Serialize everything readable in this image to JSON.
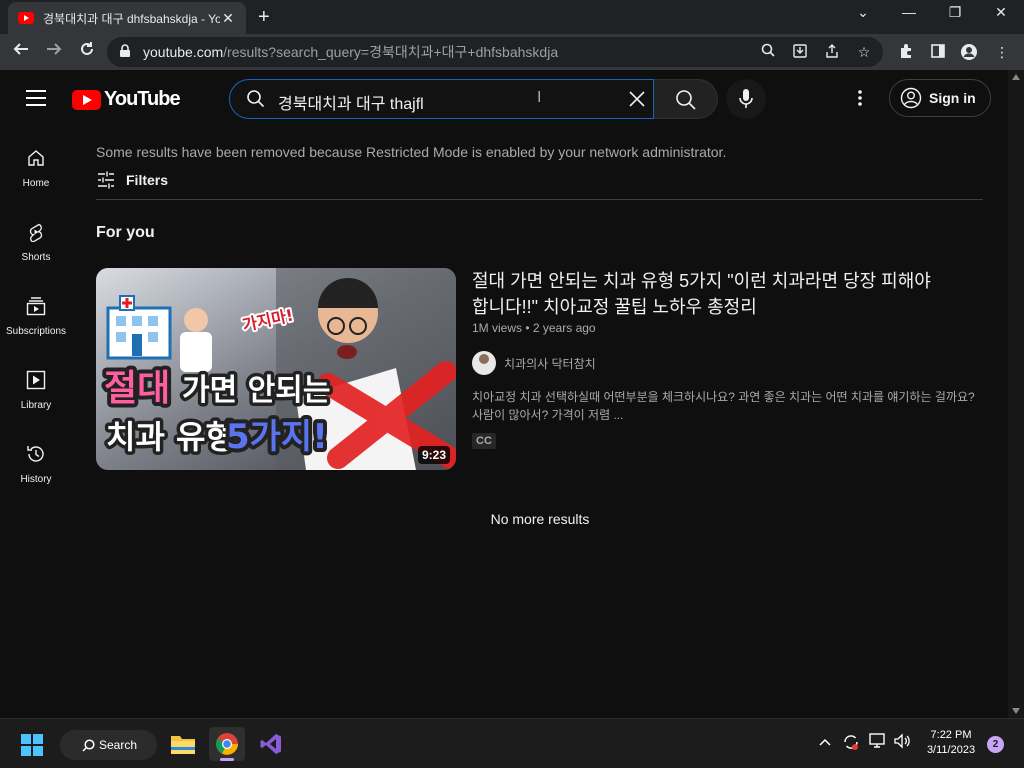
{
  "browser": {
    "tab_title": "경북대치과 대구 dhfsbahskdja - YouTube",
    "tab_close": "✕",
    "new_tab": "+",
    "url_host": "youtube.com",
    "url_path": "/results?search_query=경북대치과+대구+dhfsbahskdja"
  },
  "youtube": {
    "logo_text": "YouTube",
    "search_value": "경북대치과 대구 thajfl",
    "sign_in_label": "Sign in",
    "guide": [
      {
        "label": "Home",
        "icon": "home-icon"
      },
      {
        "label": "Shorts",
        "icon": "shorts-icon"
      },
      {
        "label": "Subscriptions",
        "icon": "subscriptions-icon"
      },
      {
        "label": "Library",
        "icon": "library-icon"
      },
      {
        "label": "History",
        "icon": "history-icon"
      }
    ],
    "restricted_notice": "Some results have been removed because Restricted Mode is enabled by your network administrator.",
    "filters_label": "Filters",
    "section_title": "For you",
    "video": {
      "title": "절대 가면 안되는 치과 유형 5가지 \"이런 치과라면 당장 피해야합니다!!\" 치아교정 꿀팁 노하우 총정리",
      "views": "1M views",
      "age": "2 years ago",
      "meta": "1M views • 2 years ago",
      "channel": "치과의사 닥터참치",
      "description": "치아교정 치과 선택하실때 어떤부분을 체크하시나요? 과연 좋은 치과는 어떤 치과를 얘기하는 걸까요? 사람이 많아서? 가격이 저렴 ...",
      "badge": "CC",
      "duration": "9:23",
      "thumb_line1_highlight": "절대",
      "thumb_line1_rest": "가면 안되는",
      "thumb_line2": "치과 유형",
      "thumb_line2_highlight": "5가지!",
      "thumb_tag": "가지마!"
    },
    "end_text": "No more results"
  },
  "taskbar": {
    "search_label": "Search",
    "time": "7:22 PM",
    "date": "3/11/2023",
    "notification_count": "2"
  },
  "colors": {
    "accent_red": "#ff0000",
    "search_focus": "#1c62b9",
    "background": "#0f0f0f"
  }
}
